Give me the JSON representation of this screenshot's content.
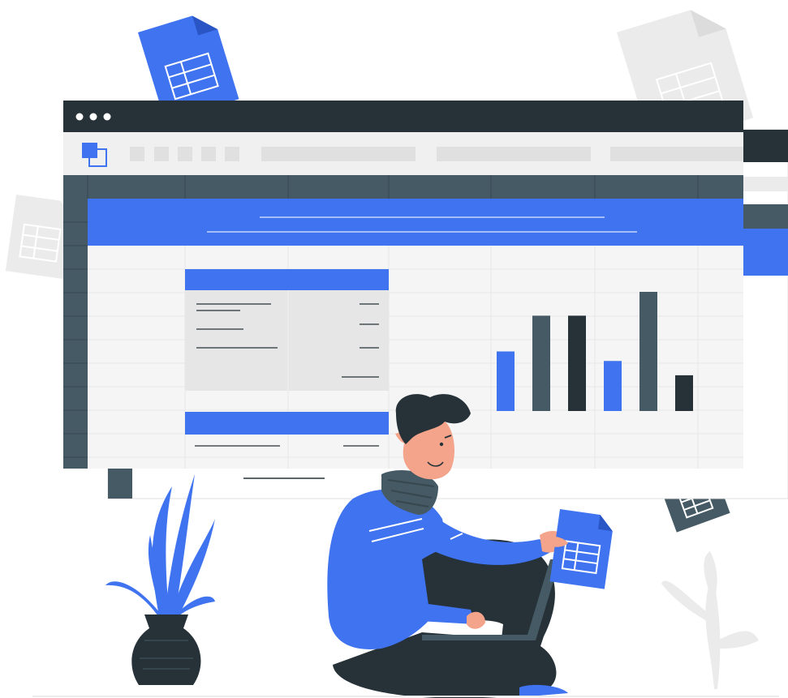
{
  "illustration": {
    "colors": {
      "accent": "#3f73ef",
      "dark": "#263238",
      "slate": "#455a64",
      "light_gray": "#ebebeb",
      "grid": "#f5f5f5",
      "skin": "#f4a48a",
      "hair": "#263238"
    },
    "window": {
      "dots": [
        "dot",
        "dot",
        "dot"
      ],
      "icon": "app-logo-icon"
    },
    "bar_levels": [
      0.5,
      0.8,
      0.8,
      0.42,
      1.0,
      0.3
    ],
    "bar_colors": [
      "#3f73ef",
      "#455a64",
      "#263238",
      "#3f73ef",
      "#455a64",
      "#263238"
    ],
    "icons": [
      "spreadsheet-file-icon",
      "plant-icon",
      "laptop-icon",
      "person-icon"
    ]
  }
}
